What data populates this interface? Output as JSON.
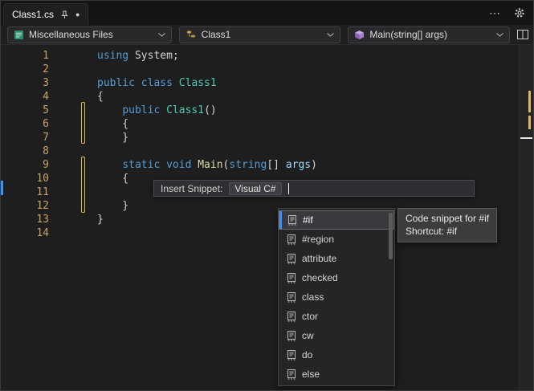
{
  "tab": {
    "title": "Class1.cs",
    "modified_indicator": "●"
  },
  "tab_bar": {
    "overflow_label": "⋯"
  },
  "navbar": {
    "project": "Miscellaneous Files",
    "type": "Class1",
    "member": "Main(string[] args)"
  },
  "code": {
    "lines": [
      {
        "num": "1",
        "segs": [
          {
            "t": "using",
            "c": "kw"
          },
          {
            "t": " System;",
            "c": "pl"
          }
        ]
      },
      {
        "num": "2",
        "segs": []
      },
      {
        "num": "3",
        "segs": [
          {
            "t": "public class ",
            "c": "kw"
          },
          {
            "t": "Class1",
            "c": "ty"
          }
        ]
      },
      {
        "num": "4",
        "segs": [
          {
            "t": "{",
            "c": "pl"
          }
        ]
      },
      {
        "num": "5",
        "segs": [
          {
            "t": "    ",
            "c": "pl"
          },
          {
            "t": "public ",
            "c": "kw"
          },
          {
            "t": "Class1",
            "c": "ty"
          },
          {
            "t": "()",
            "c": "pl"
          }
        ]
      },
      {
        "num": "6",
        "segs": [
          {
            "t": "    {",
            "c": "pl"
          }
        ]
      },
      {
        "num": "7",
        "segs": [
          {
            "t": "    }",
            "c": "pl"
          }
        ]
      },
      {
        "num": "8",
        "segs": []
      },
      {
        "num": "9",
        "segs": [
          {
            "t": "    ",
            "c": "pl"
          },
          {
            "t": "static void ",
            "c": "kw"
          },
          {
            "t": "Main",
            "c": "me"
          },
          {
            "t": "(",
            "c": "pl"
          },
          {
            "t": "string",
            "c": "kw"
          },
          {
            "t": "[] ",
            "c": "pl"
          },
          {
            "t": "args",
            "c": "pa"
          },
          {
            "t": ")",
            "c": "pl"
          }
        ]
      },
      {
        "num": "10",
        "segs": [
          {
            "t": "    {",
            "c": "pl"
          }
        ]
      },
      {
        "num": "11",
        "segs": []
      },
      {
        "num": "12",
        "segs": [
          {
            "t": "    }",
            "c": "pl"
          }
        ]
      },
      {
        "num": "13",
        "segs": [
          {
            "t": "}",
            "c": "pl"
          }
        ]
      },
      {
        "num": "14",
        "segs": []
      }
    ]
  },
  "snippet_bar": {
    "label": "Insert Snippet:",
    "language": "Visual C#"
  },
  "completion_list": {
    "items": [
      {
        "label": "#if",
        "selected": true
      },
      {
        "label": "#region",
        "selected": false
      },
      {
        "label": "attribute",
        "selected": false
      },
      {
        "label": "checked",
        "selected": false
      },
      {
        "label": "class",
        "selected": false
      },
      {
        "label": "ctor",
        "selected": false
      },
      {
        "label": "cw",
        "selected": false
      },
      {
        "label": "do",
        "selected": false
      },
      {
        "label": "else",
        "selected": false
      }
    ]
  },
  "tooltip": {
    "line1": "Code snippet for #if",
    "line2": "Shortcut: #if"
  },
  "colors": {
    "keyword": "#569cd6",
    "type": "#4ec9b0",
    "method": "#dcdcaa",
    "param": "#9cdcfe",
    "plain": "#d4d4d4",
    "line_number": "#c8a165",
    "change_bar": "#dcb85c",
    "accent_blue": "#3794ff"
  }
}
